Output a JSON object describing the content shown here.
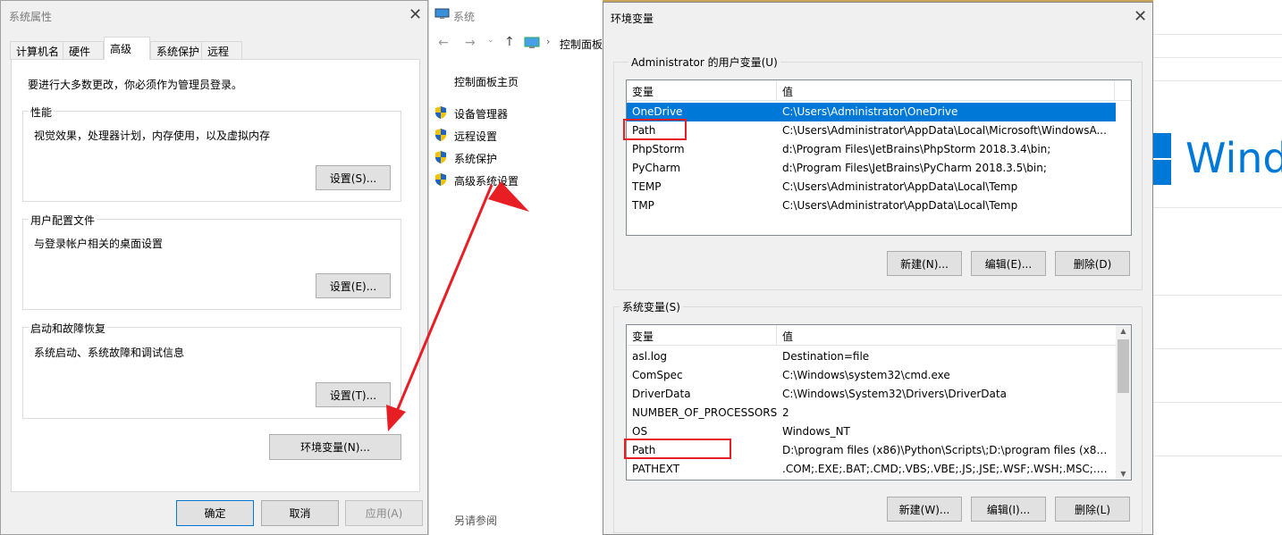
{
  "sysprops": {
    "title": "系统属性",
    "tabs": [
      "计算机名",
      "硬件",
      "高级",
      "系统保护",
      "远程"
    ],
    "notice": "要进行大多数更改，你必须作为管理员登录。",
    "performance": {
      "label": "性能",
      "desc": "视觉效果，处理器计划，内存使用，以及虚拟内存",
      "button": "设置(S)..."
    },
    "profiles": {
      "label": "用户配置文件",
      "desc": "与登录帐户相关的桌面设置",
      "button": "设置(E)..."
    },
    "startup": {
      "label": "启动和故障恢复",
      "desc": "系统启动、系统故障和调试信息",
      "button": "设置(T)..."
    },
    "env_button": "环境变量(N)...",
    "ok": "确定",
    "cancel": "取消",
    "apply": "应用(A)"
  },
  "controlpanel": {
    "title": "系统",
    "breadcrumb": "控制面板",
    "home": "控制面板主页",
    "links": [
      "设备管理器",
      "远程设置",
      "系统保护",
      "高级系统设置"
    ],
    "see_also": "另请参阅"
  },
  "background": {
    "logo_text": "Wind"
  },
  "envvars": {
    "title": "环境变量",
    "user_section": "Administrator 的用户变量(U)",
    "system_section": "系统变量(S)",
    "col_var": "变量",
    "col_val": "值",
    "user_vars": [
      {
        "name": "OneDrive",
        "value": "C:\\Users\\Administrator\\OneDrive"
      },
      {
        "name": "Path",
        "value": "C:\\Users\\Administrator\\AppData\\Local\\Microsoft\\WindowsA..."
      },
      {
        "name": "PhpStorm",
        "value": "d:\\Program Files\\JetBrains\\PhpStorm 2018.3.4\\bin;"
      },
      {
        "name": "PyCharm",
        "value": "d:\\Program Files\\JetBrains\\PyCharm 2018.3.5\\bin;"
      },
      {
        "name": "TEMP",
        "value": "C:\\Users\\Administrator\\AppData\\Local\\Temp"
      },
      {
        "name": "TMP",
        "value": "C:\\Users\\Administrator\\AppData\\Local\\Temp"
      }
    ],
    "system_vars": [
      {
        "name": "asl.log",
        "value": "Destination=file"
      },
      {
        "name": "ComSpec",
        "value": "C:\\Windows\\system32\\cmd.exe"
      },
      {
        "name": "DriverData",
        "value": "C:\\Windows\\System32\\Drivers\\DriverData"
      },
      {
        "name": "NUMBER_OF_PROCESSORS",
        "value": "2"
      },
      {
        "name": "OS",
        "value": "Windows_NT"
      },
      {
        "name": "Path",
        "value": "D:\\program files (x86)\\Python\\Scripts\\;D:\\program files (x86)\\..."
      },
      {
        "name": "PATHEXT",
        "value": ".COM;.EXE;.BAT;.CMD;.VBS;.VBE;.JS;.JSE;.WSF;.WSH;.MSC;.PY;.P..."
      }
    ],
    "user_buttons": {
      "new": "新建(N)...",
      "edit": "编辑(E)...",
      "delete": "删除(D)"
    },
    "system_buttons": {
      "new": "新建(W)...",
      "edit": "编辑(I)...",
      "delete": "删除(L)"
    }
  },
  "colors": {
    "accent": "#0078d7",
    "annotation": "#e81e25"
  }
}
